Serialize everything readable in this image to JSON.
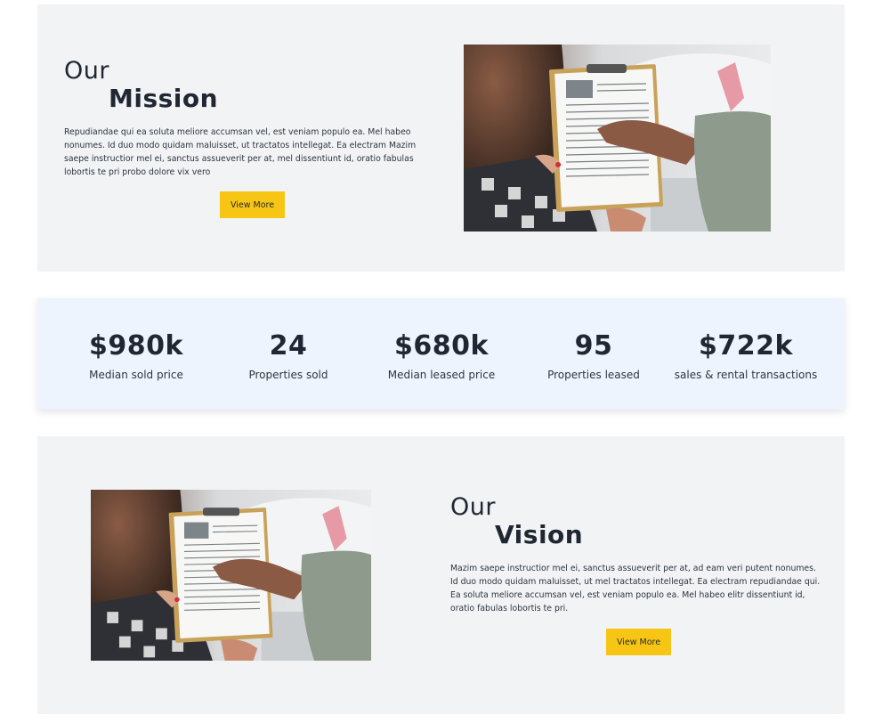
{
  "mission": {
    "title_line1": "Our",
    "title_line2": "Mission",
    "body": "Repudiandae qui ea soluta meliore accumsan vel, est veniam populo ea. Mel habeo nonumes. Id duo modo quidam maluisset, ut tractatos intellegat. Ea electram Mazim saepe instructior mel ei, sanctus assueverit per at, mel dissentiunt id, oratio fabulas lobortis te pri probo dolore vix vero",
    "button_label": "View More",
    "image_subject": "clipboard-document-photo"
  },
  "stats": {
    "items": [
      {
        "value": "$980k",
        "label": "Median sold price"
      },
      {
        "value": "24",
        "label": "Properties sold"
      },
      {
        "value": "$680k",
        "label": "Median leased price"
      },
      {
        "value": "95",
        "label": "Properties leased"
      },
      {
        "value": "$722k",
        "label": "sales & rental transactions"
      }
    ]
  },
  "vision": {
    "title_line1": "Our",
    "title_line2": "Vision",
    "body": "Mazim saepe instructior mel ei, sanctus assueverit per at, ad eam veri putent nonumes. Id duo modo quidam maluisset, ut mel tractatos intellegat. Ea electram repudiandae qui. Ea soluta meliore accumsan vel, est veniam populo ea. Mel habeo elitr dissentiunt id, oratio fabulas lobortis te pri.",
    "button_label": "View More",
    "image_subject": "clipboard-document-photo"
  },
  "colors": {
    "section_bg": "#f2f3f5",
    "stats_bg": "#eef4fd",
    "button_bg": "#f7c614",
    "heading": "#1f2733"
  }
}
